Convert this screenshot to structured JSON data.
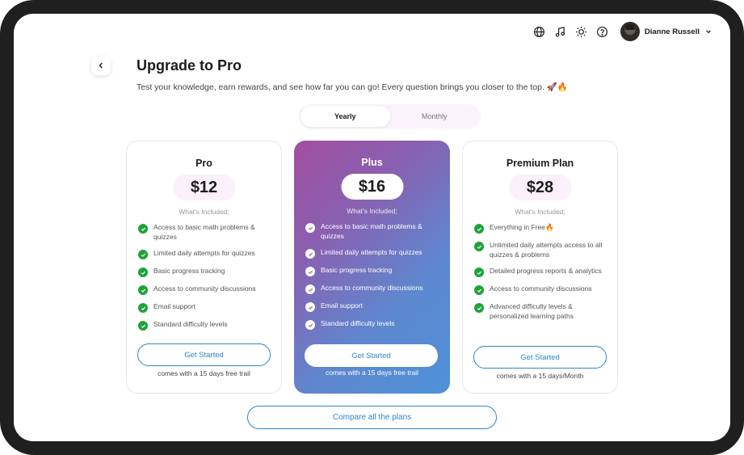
{
  "topbar": {
    "icons": [
      "globe-icon",
      "music-icon",
      "sun-icon",
      "help-icon"
    ],
    "user_name": "Dianne Russell"
  },
  "header": {
    "title": "Upgrade to Pro",
    "subtitle": "Test your knowledge, earn rewards, and see how far you can go! Every question brings you closer to the top. 🚀🔥"
  },
  "billing_toggle": {
    "options": [
      "Yearly",
      "Monthly"
    ],
    "selected": "Yearly"
  },
  "plans": [
    {
      "name": "Pro",
      "price": "$12",
      "included_label": "What's Included;",
      "features": [
        "Access to basic math problems & quizzes",
        "Limited daily attempts for quizzes",
        "Basic progress tracking",
        "Access to community discussions",
        "Email support",
        "Standard difficulty levels"
      ],
      "cta": "Get Started",
      "note": "comes with a 15 days free trail"
    },
    {
      "name": "Plus",
      "price": "$16",
      "included_label": "What's Included;",
      "features": [
        "Access to basic math problems & quizzes",
        "Limited daily attempts for quizzes",
        "Basic progress tracking",
        "Access to community discussions",
        "Email support",
        "Standard difficulty levels"
      ],
      "cta": "Get Started",
      "note": "comes with a 15 days free trail"
    },
    {
      "name": "Premium Plan",
      "price": "$28",
      "included_label": "What's Included;",
      "features": [
        "Everything in Free🔥",
        "Unlimited daily attempts access to all quizzes & problems",
        "Detailed progress reports & analytics",
        "Access to community discussions",
        "Advanced difficulty levels & personalized learning paths"
      ],
      "cta": "Get Started",
      "note": "comes with a 15 days/Month"
    }
  ],
  "compare_button": "Compare all the plans",
  "colors": {
    "accent": "#2f86cf",
    "check": "#1ea33b",
    "plus_gradient_start": "#a24f9f",
    "plus_gradient_end": "#4d92d8",
    "price_pill": "#fbf0fb"
  }
}
